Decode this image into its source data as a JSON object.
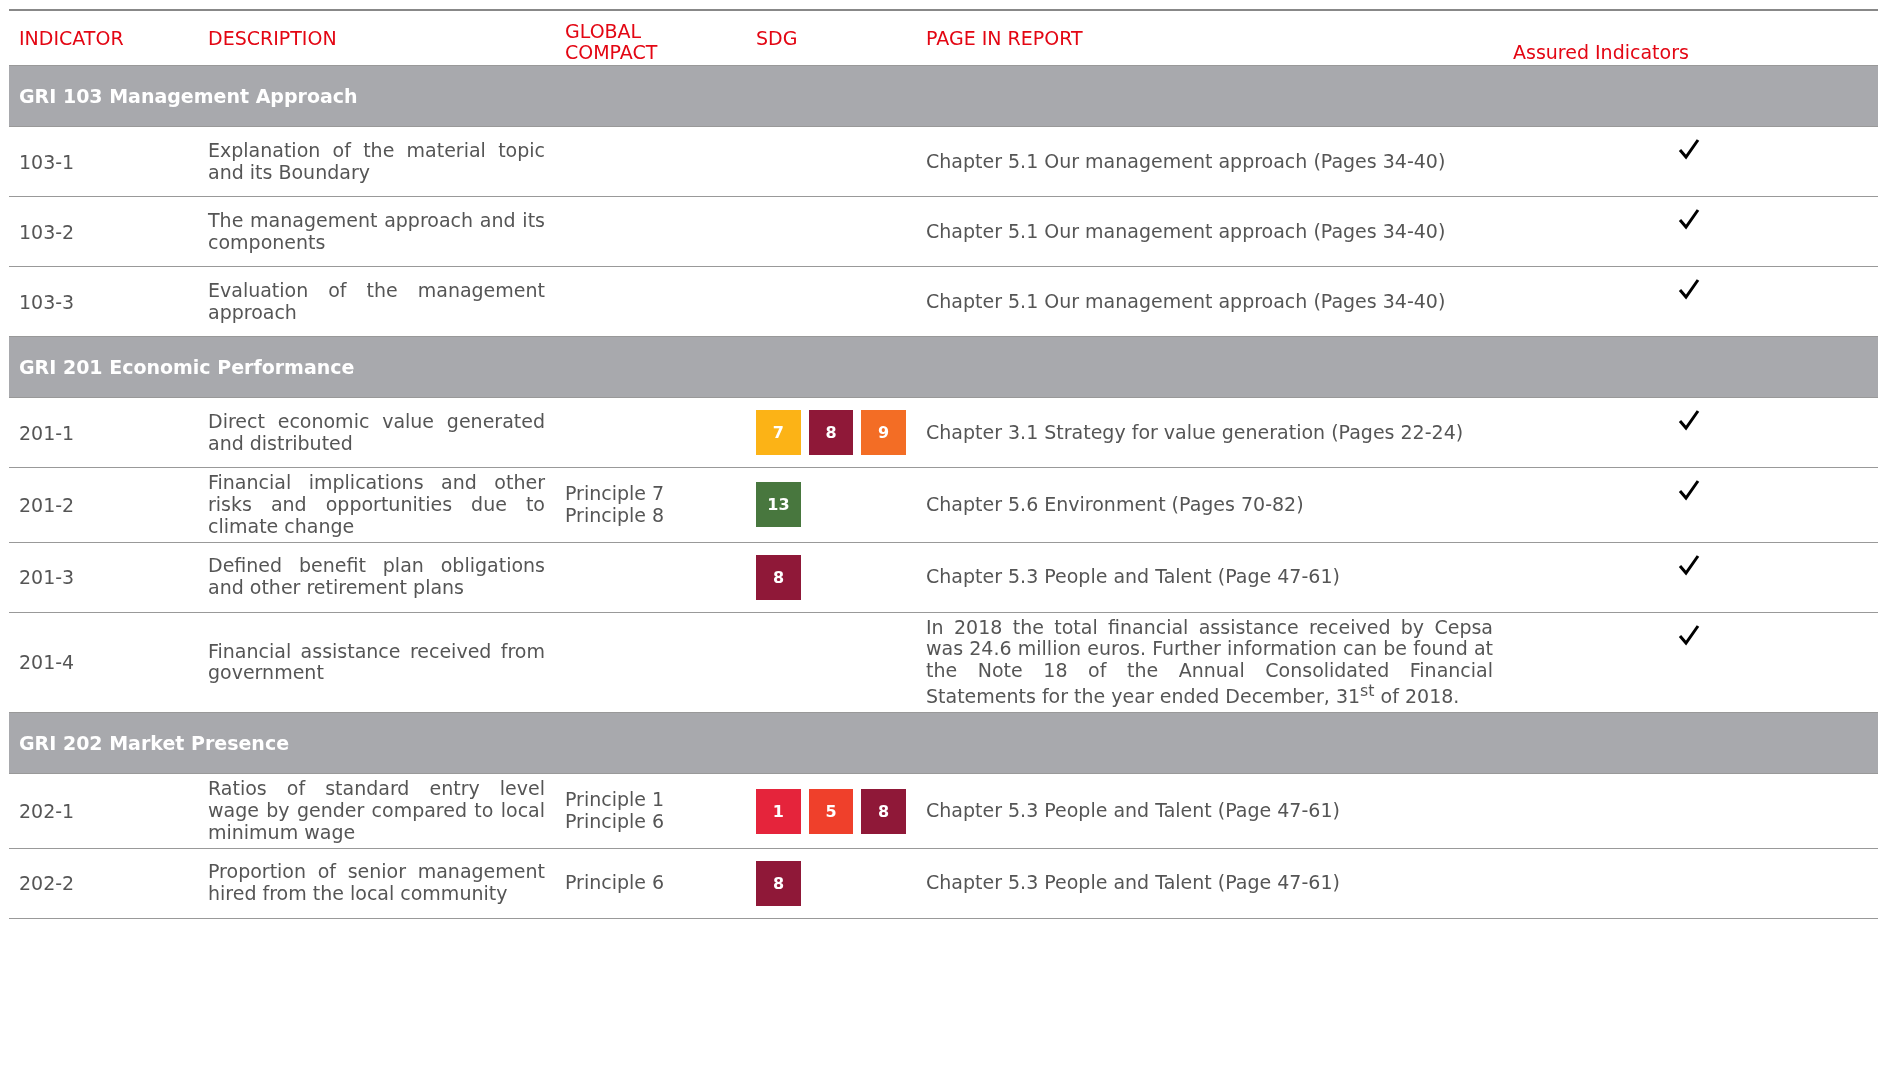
{
  "columns": [
    "INDICATOR",
    "DESCRIPTION",
    "GLOBAL COMPACT",
    "SDG",
    "PAGE IN REPORT",
    "Assured Indicators"
  ],
  "sections": [
    {
      "title": "GRI 103 Management Approach",
      "rows": [
        {
          "indicator": "103-1",
          "description": "Explanation of the material topic and its Boundary",
          "principles": [],
          "sdgs": [],
          "page": "Chapter 5.1 Our management approach (Pages 34-40)",
          "assured": true
        },
        {
          "indicator": "103-2",
          "description": "The management approach and its components",
          "principles": [],
          "sdgs": [],
          "page": "Chapter 5.1 Our management approach (Pages 34-40)",
          "assured": true
        },
        {
          "indicator": "103-3",
          "description": "Evaluation of the management approach",
          "principles": [],
          "sdgs": [],
          "page": "Chapter 5.1 Our management approach (Pages 34-40)",
          "assured": true
        }
      ]
    },
    {
      "title": "GRI 201 Economic Performance",
      "rows": [
        {
          "indicator": "201-1",
          "description": "Direct economic value generated and distributed",
          "principles": [],
          "sdgs": [
            {
              "label": "7",
              "color": "#fcb316"
            },
            {
              "label": "8",
              "color": "#8f1838"
            },
            {
              "label": "9",
              "color": "#f36d25"
            }
          ],
          "page": "Chapter 3.1 Strategy for value generation (Pages 22-24)",
          "assured": true
        },
        {
          "indicator": "201-2",
          "description": "Financial implications and other risks and opportunities due to climate change",
          "principles": [
            "Principle 7",
            "Principle 8"
          ],
          "sdgs": [
            {
              "label": "13",
              "color": "#48773e"
            }
          ],
          "page": "Chapter 5.6 Environment (Pages 70-82)",
          "assured": true
        },
        {
          "indicator": "201-3",
          "description": "Defined benefit plan obligations and other retirement plans",
          "principles": [],
          "sdgs": [
            {
              "label": "8",
              "color": "#8f1838"
            }
          ],
          "page": "Chapter 5.3 People and Talent (Page 47-61)",
          "assured": true
        },
        {
          "indicator": "201-4",
          "description": "Financial assistance received from government",
          "principles": [],
          "sdgs": [],
          "page": "In 2018 the total financial assistance received by Cepsa was 24.6 million euros. Further information can be found at the Note 18 of the Annual Consolidated Financial Statements for the year ended December, 31$^{st}$ of 2018.",
          "assured": true
        }
      ]
    },
    {
      "title": "GRI 202 Market Presence",
      "rows": [
        {
          "indicator": "202-1",
          "description": "Ratios of standard entry level wage by gender compared to local minimum wage",
          "principles": [
            "Principle 1",
            "Principle 6"
          ],
          "sdgs": [
            {
              "label": "1",
              "color": "#e5243b"
            },
            {
              "label": "5",
              "color": "#ef402b"
            },
            {
              "label": "8",
              "color": "#8f1838"
            }
          ],
          "page": "Chapter 5.3 People and Talent (Page 47-61)",
          "assured": false
        },
        {
          "indicator": "202-2",
          "description": "Proportion of senior management hired from the local community",
          "principles": [
            "Principle 6"
          ],
          "sdgs": [
            {
              "label": "8",
              "color": "#8f1838"
            }
          ],
          "page": "Chapter 5.3 People and Talent (Page 47-61)",
          "assured": false
        }
      ]
    }
  ]
}
